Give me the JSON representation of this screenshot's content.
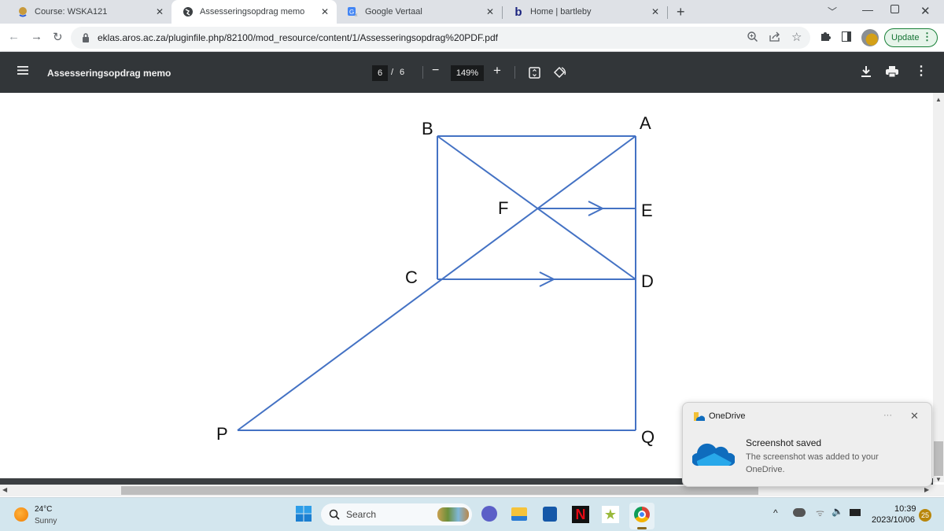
{
  "browser": {
    "tabs": [
      {
        "title": "Course: WSKA121",
        "icon": "moodle-logo-icon",
        "active": false
      },
      {
        "title": "Assesseringsopdrag memo",
        "icon": "globe-icon",
        "active": true
      },
      {
        "title": "Google Vertaal",
        "icon": "google-translate-icon",
        "active": false
      },
      {
        "title": "Home | bartleby",
        "icon": "bartleby-logo-icon",
        "active": false
      }
    ],
    "new_tab_glyph": "+",
    "url": "eklas.aros.ac.za/pluginfile.php/82100/mod_resource/content/1/Assesseringsopdrag%20PDF.pdf",
    "update_label": "Update",
    "colors": {
      "tabstrip": "#dee1e6",
      "update_green": "#188038"
    }
  },
  "pdf": {
    "title": "Assesseringsopdrag memo",
    "current_page": "6",
    "total_pages": "6",
    "page_sep": "/",
    "zoom": "149%"
  },
  "diagram": {
    "line_color": "#4472c4",
    "labels": {
      "A": "A",
      "B": "B",
      "C": "C",
      "D": "D",
      "E": "E",
      "F": "F",
      "P": "P",
      "Q": "Q"
    }
  },
  "notification": {
    "app": "OneDrive",
    "title": "Screenshot saved",
    "body": "The screenshot was added to your OneDrive.",
    "more_glyph": "···",
    "close_glyph": "✕"
  },
  "taskbar": {
    "weather_temp": "24°C",
    "weather_desc": "Sunny",
    "search_label": "Search",
    "time": "10:39",
    "date": "2023/10/06",
    "notification_count": "25",
    "apps": [
      "teams-icon",
      "file-explorer-icon",
      "microsoft-store-icon",
      "netflix-icon",
      "star-app-icon",
      "chrome-icon"
    ]
  }
}
